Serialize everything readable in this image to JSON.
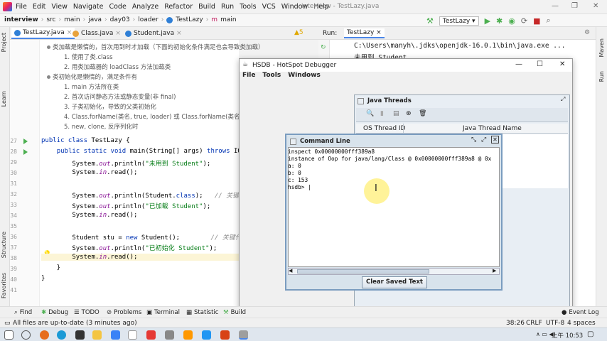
{
  "window": {
    "title": "interview - TestLazy.java"
  },
  "menu": [
    "File",
    "Edit",
    "View",
    "Navigate",
    "Code",
    "Analyze",
    "Refactor",
    "Build",
    "Run",
    "Tools",
    "VCS",
    "Window",
    "Help"
  ],
  "breadcrumb": [
    "interview",
    "src",
    "main",
    "java",
    "day03",
    "loader",
    "TestLazy",
    "main"
  ],
  "run_config": "TestLazy",
  "editor_tabs": [
    {
      "label": "TestLazy.java"
    },
    {
      "label": "Class.java"
    },
    {
      "label": "Student.java"
    }
  ],
  "warnings_badge": "▲5",
  "notes": [
    "类加载是懒惰的，首次用到时才加载（下面的初始化条件满足也会导致类加载）",
    "1. 使用了类.class",
    "2. 用类加载器的 loadClass 方法加载类",
    "类初始化是懒惰的，满足条件有",
    "1. main 方法所在类",
    "2. 首次访问静态方法或静态变量(非 final)",
    "3. 子类初始化，导致的父类初始化",
    "4. Class.forName(类名, true, loader) 或 Class.forName(类名)",
    "5. new, clone, 反序列化时"
  ],
  "line_numbers": [
    "27",
    "28",
    "29",
    "30",
    "31",
    "32",
    "33",
    "34",
    "35",
    "36",
    "37",
    "38",
    "39",
    "40",
    "41"
  ],
  "run_panel": {
    "label": "Run:",
    "tab": "TestLazy",
    "console": [
      "C:\\Users\\manyh\\.jdks\\openjdk-16.0.1\\bin\\java.exe ...",
      "未用到 Student"
    ]
  },
  "hsdb": {
    "title": "HSDB - HotSpot Debugger",
    "menu": [
      "File",
      "Tools",
      "Windows"
    ],
    "java_threads": {
      "title": "Java Threads",
      "columns": [
        "OS Thread ID",
        "Java Thread Name"
      ]
    },
    "command_line": {
      "title": "Command Line",
      "lines": [
        "inspect 0x00000000fff389a8",
        "instance of Oop for java/lang/Class @ 0x00000000fff389a8 @ 0x",
        "a: 0",
        "b: 0",
        "c: 153",
        "hsdb> |"
      ],
      "button": "Clear Saved Text"
    }
  },
  "left_strip": [
    "Project",
    "Learn",
    "Structure",
    "Favorites"
  ],
  "right_strip": [
    "Maven",
    "Run"
  ],
  "bottom_tools": [
    "Find",
    "Debug",
    "TODO",
    "Problems",
    "Terminal",
    "Statistic",
    "Build"
  ],
  "event_log": "Event Log",
  "status": {
    "message": "All files are up-to-date (3 minutes ago)",
    "position": "38:26",
    "line_sep": "CRLF",
    "encoding": "UTF-8",
    "indent": "4 spaces"
  },
  "taskbar": {
    "clock": "上午 10:53"
  },
  "colors": {
    "accent": "#4a86e8",
    "run_green": "#4caf50",
    "keyword": "#0033b3",
    "string": "#067d17"
  }
}
